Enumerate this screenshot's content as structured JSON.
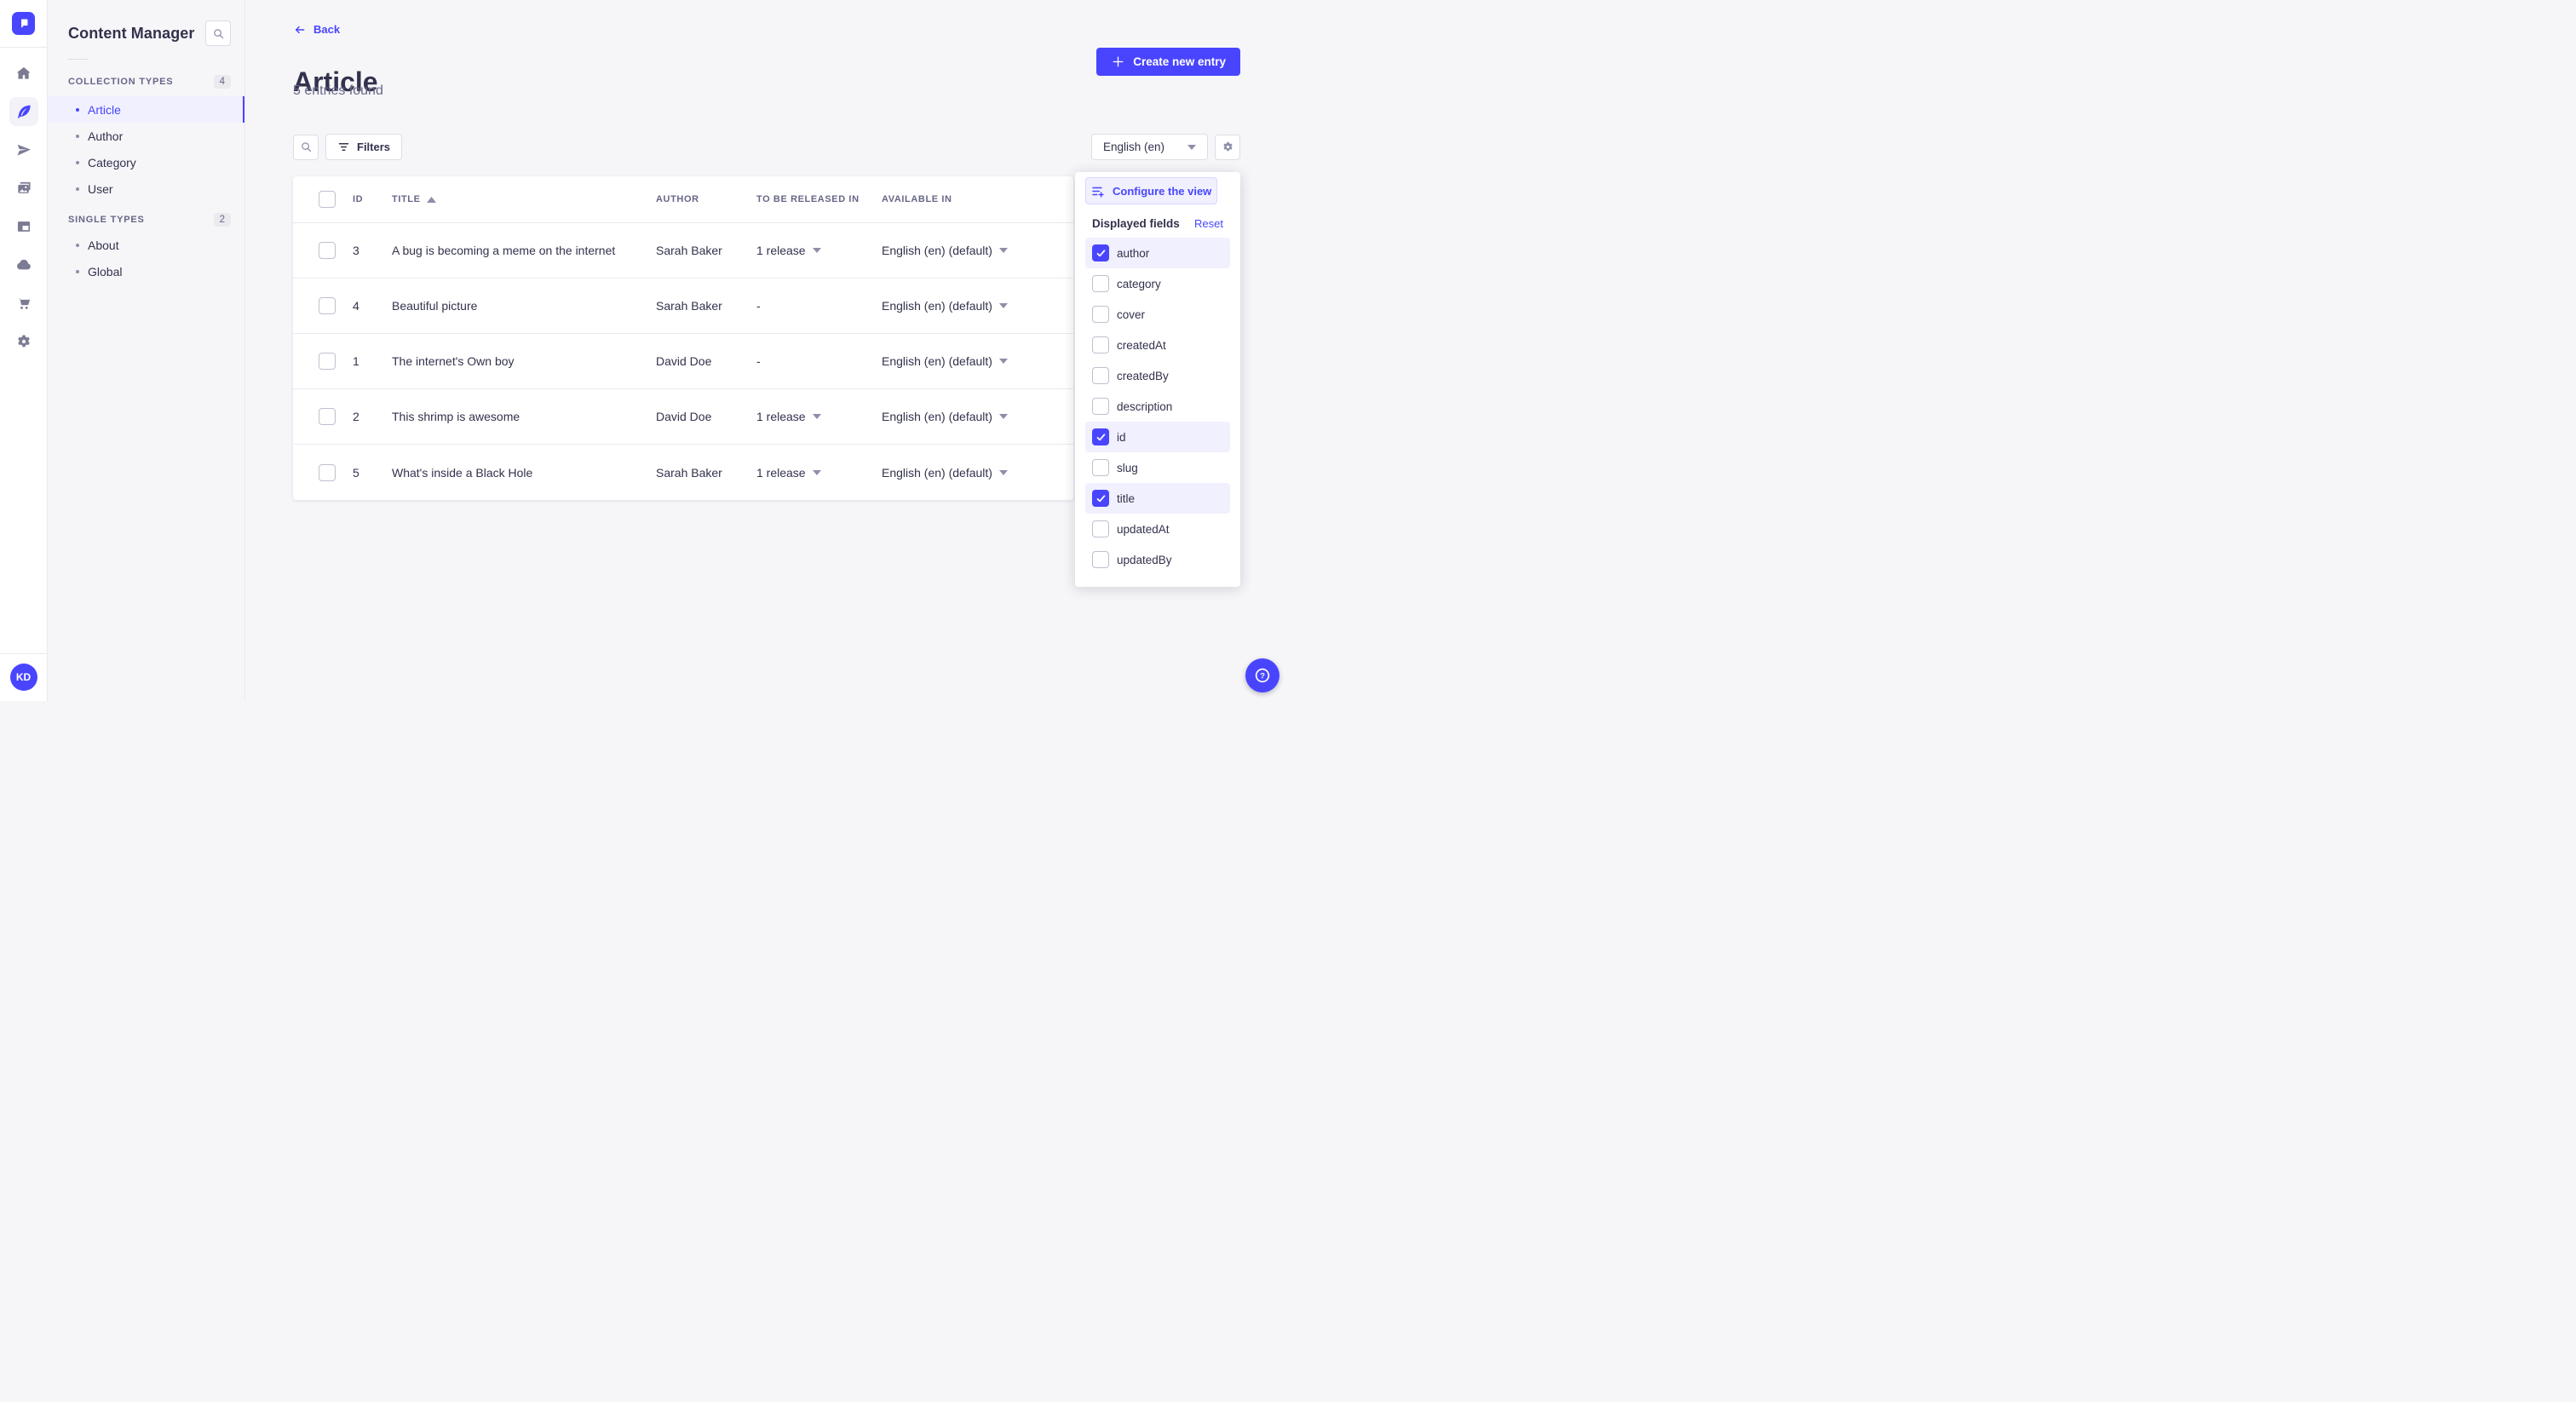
{
  "colors": {
    "primary": "#4945ff",
    "primary_bg": "#f0f0ff",
    "text": "#32324d",
    "text_secondary": "#666687",
    "app_bg": "#f6f6f9"
  },
  "nav_rail": {
    "icons": [
      "strapi-logo-icon",
      "home-icon",
      "content-manager-feather-icon",
      "releases-paper-plane-icon",
      "media-library-images-icon",
      "content-type-builder-layout-icon",
      "cloud-icon",
      "marketplace-cart-icon",
      "settings-gear-icon",
      "help-icon"
    ],
    "avatar_initials": "KD"
  },
  "sidebar": {
    "title": "Content Manager",
    "search_icon": "search-icon",
    "sections": [
      {
        "label": "COLLECTION TYPES",
        "count": "4",
        "items": [
          {
            "label": "Article",
            "active": true
          },
          {
            "label": "Author"
          },
          {
            "label": "Category"
          },
          {
            "label": "User"
          }
        ]
      },
      {
        "label": "SINGLE TYPES",
        "count": "2",
        "items": [
          {
            "label": "About"
          },
          {
            "label": "Global"
          }
        ]
      }
    ]
  },
  "header": {
    "back_label": "Back",
    "title": "Article",
    "subtitle": "5 entries found",
    "create_button_label": "Create new entry"
  },
  "toolbar": {
    "filters_label": "Filters",
    "locale_selected": "English (en)"
  },
  "table": {
    "columns": [
      "ID",
      "TITLE",
      "AUTHOR",
      "TO BE RELEASED IN",
      "AVAILABLE IN"
    ],
    "sorted_column": "TITLE",
    "sort_direction": "asc",
    "rows": [
      {
        "id": "3",
        "title": "A bug is becoming a meme on the internet",
        "author": "Sarah Baker",
        "release": "1 release",
        "available": "English (en) (default)"
      },
      {
        "id": "4",
        "title": "Beautiful picture",
        "author": "Sarah Baker",
        "release": "-",
        "available": "English (en) (default)"
      },
      {
        "id": "1",
        "title": "The internet's Own boy",
        "author": "David Doe",
        "release": "-",
        "available": "English (en) (default)"
      },
      {
        "id": "2",
        "title": "This shrimp is awesome",
        "author": "David Doe",
        "release": "1 release",
        "available": "English (en) (default)"
      },
      {
        "id": "5",
        "title": "What's inside a Black Hole",
        "author": "Sarah Baker",
        "release": "1 release",
        "available": "English (en) (default)"
      }
    ]
  },
  "popover": {
    "configure_label": "Configure the view",
    "heading": "Displayed fields",
    "reset_label": "Reset",
    "fields": [
      {
        "label": "author",
        "checked": true
      },
      {
        "label": "category",
        "checked": false
      },
      {
        "label": "cover",
        "checked": false
      },
      {
        "label": "createdAt",
        "checked": false
      },
      {
        "label": "createdBy",
        "checked": false
      },
      {
        "label": "description",
        "checked": false
      },
      {
        "label": "id",
        "checked": true
      },
      {
        "label": "slug",
        "checked": false
      },
      {
        "label": "title",
        "checked": true
      },
      {
        "label": "updatedAt",
        "checked": false
      },
      {
        "label": "updatedBy",
        "checked": false
      }
    ]
  }
}
